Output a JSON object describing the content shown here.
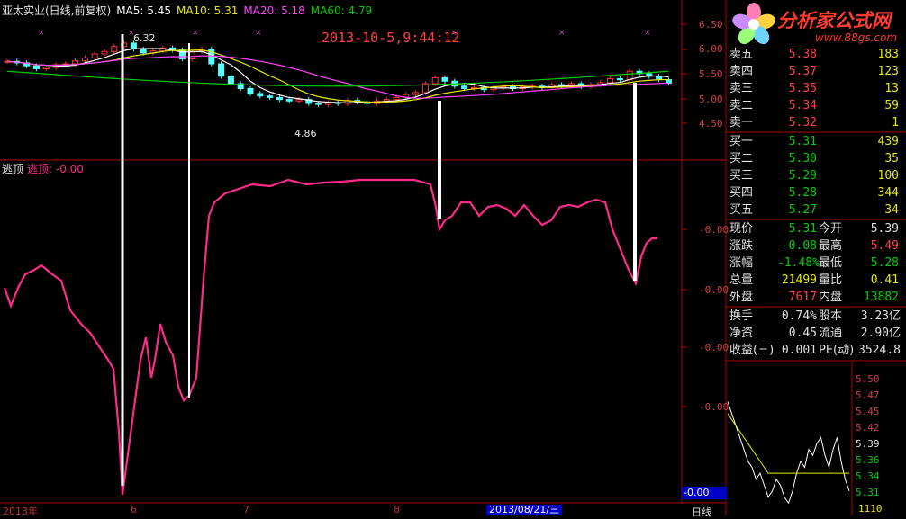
{
  "header": {
    "stock_title": "亚太实业(日线,前复权)",
    "ma5": "MA5: 5.45",
    "ma10": "MA10: 5.31",
    "ma20": "MA20: 5.18",
    "ma60": "MA60: 4.79"
  },
  "timestamp": "2013-10-5,9:44:12",
  "price_labels": {
    "high": "6.32",
    "low": "4.86"
  },
  "indicator": {
    "name": "逃顶",
    "label": "逃顶: -0.00"
  },
  "y_axis_main": [
    "6.50",
    "6.00",
    "5.50",
    "5.00",
    "4.50"
  ],
  "y_axis_indicator": [
    "-0.00",
    "-0.00",
    "-0.00",
    "-0.00"
  ],
  "current_value_box": "-0.00",
  "x_axis": [
    "2013年",
    "6",
    "7",
    "8",
    "2013/08/21/三"
  ],
  "period_label": "日线",
  "logo": {
    "text": "分析家公式网",
    "url": "www.88gs.com"
  },
  "colors": {
    "up": "#ff3333",
    "down": "#54ffff",
    "ma5": "#ffffff",
    "ma10": "#e8e800",
    "ma20": "#ff44ff",
    "ma60": "#00cc00",
    "indicator": "#ff2a8a"
  },
  "order_book": {
    "asks": [
      {
        "label": "卖五",
        "price": "5.38",
        "vol": "183"
      },
      {
        "label": "卖四",
        "price": "5.37",
        "vol": "123"
      },
      {
        "label": "卖三",
        "price": "5.35",
        "vol": "13"
      },
      {
        "label": "卖二",
        "price": "5.34",
        "vol": "59"
      },
      {
        "label": "卖一",
        "price": "5.32",
        "vol": "1"
      }
    ],
    "bids": [
      {
        "label": "买一",
        "price": "5.31",
        "vol": "439"
      },
      {
        "label": "买二",
        "price": "5.30",
        "vol": "35"
      },
      {
        "label": "买三",
        "price": "5.29",
        "vol": "100"
      },
      {
        "label": "买四",
        "price": "5.28",
        "vol": "344"
      },
      {
        "label": "买五",
        "price": "5.27",
        "vol": "34"
      }
    ]
  },
  "stats": [
    {
      "l1": "现价",
      "v1": "5.31",
      "l2": "今开",
      "v2": "5.39"
    },
    {
      "l1": "涨跌",
      "v1": "-0.08",
      "l2": "最高",
      "v2": "5.49"
    },
    {
      "l1": "涨幅",
      "v1": "-1.48%",
      "l2": "最低",
      "v2": "5.28"
    },
    {
      "l1": "总量",
      "v1": "21499",
      "l2": "量比",
      "v2": "0.41"
    },
    {
      "l1": "外盘",
      "v1": "7617",
      "l2": "内盘",
      "v2": "13882"
    }
  ],
  "fundamentals": [
    {
      "l1": "换手",
      "v1": "0.74%",
      "l2": "股本",
      "v2": "3.23亿"
    },
    {
      "l1": "净资",
      "v1": "0.45",
      "l2": "流通",
      "v2": "2.90亿"
    },
    {
      "l1": "收益(三)",
      "v1": "0.001",
      "l2": "PE(动)",
      "v2": "3524.8"
    }
  ],
  "intraday_y": [
    "5.50",
    "5.47",
    "5.45",
    "5.42",
    "5.39",
    "5.36",
    "5.34",
    "5.31"
  ],
  "intraday_vol": "1110"
}
